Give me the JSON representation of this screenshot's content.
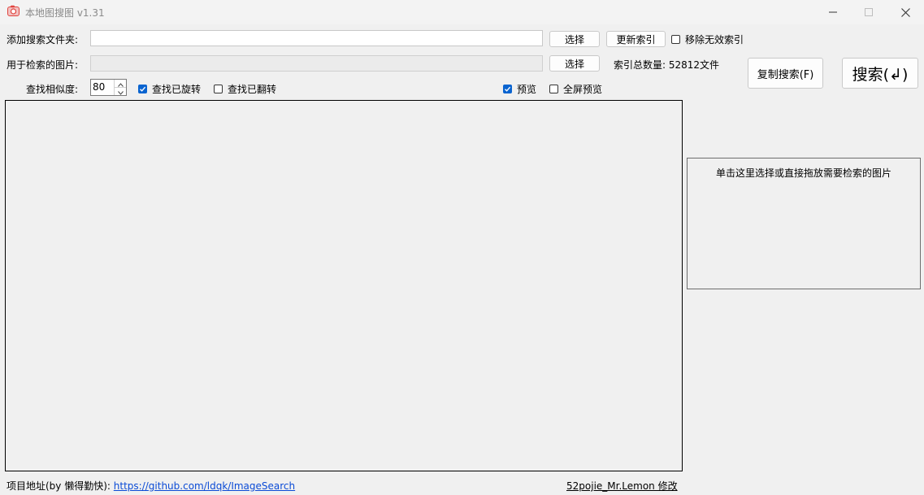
{
  "window": {
    "title": "本地图搜图 v1.31"
  },
  "form": {
    "add_folder_label": "添加搜索文件夹:",
    "add_folder_value": "",
    "search_image_label": "用于检索的图片:",
    "search_image_value": "",
    "select_button_1": "选择",
    "select_button_2": "选择",
    "update_index_button": "更新索引",
    "remove_invalid_label": "移除无效索引",
    "remove_invalid_checked": false,
    "index_count_text": "索引总数量: 52812文件",
    "copy_search_button": "复制搜索(F)",
    "search_button": "搜索(↲)",
    "similarity_label": "查找相似度:",
    "similarity_value": "80",
    "find_rotated_label": "查找已旋转",
    "find_rotated_checked": true,
    "find_flipped_label": "查找已翻转",
    "find_flipped_checked": false,
    "preview_label": "预览",
    "preview_checked": true,
    "fullscreen_preview_label": "全屏预览",
    "fullscreen_preview_checked": false
  },
  "drop_area": {
    "text": "单击这里选择或直接拖放需要检索的图片"
  },
  "footer": {
    "project_label": "项目地址(by 懒得勤快):",
    "project_link": "https://github.com/ldqk/ImageSearch",
    "author_text": "52pojie_Mr.Lemon 修改"
  },
  "colors": {
    "accent": "#0a64d0",
    "link": "#0b4bd6",
    "background": "#f0f0f0"
  },
  "icons": {
    "app": "camera-icon",
    "minimize": "minimize-icon",
    "maximize": "maximize-icon",
    "close": "close-icon"
  }
}
